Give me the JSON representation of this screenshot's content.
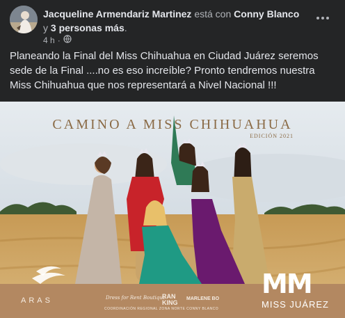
{
  "post": {
    "author": "Jacqueline Armendariz Martinez",
    "with_word": "está con",
    "tagged": "Conny Blanco",
    "and_word": "y",
    "others": "3 personas más",
    "period": ".",
    "time": "4 h",
    "dot": "·",
    "text": "Planeando la Final del Miss Chihuahua en Ciudad Juárez seremos sede de la Final ....no es eso increíble? Pronto tendremos nuestra Miss Chihuahua que nos representará a Nivel Nacional !!!"
  },
  "photo": {
    "title": "CAMINO A MISS CHIHUAHUA",
    "edition": "EDICIÓN 2021",
    "footer": {
      "aras": "ARAS",
      "dress": "Dress for Rent Boutique",
      "ranking_top": "RAN",
      "ranking_bottom": "KING",
      "marlene": "MARLENE BO",
      "coordination": "COORDINACIÓN REGIONAL ZONA NORTE CONNY BLANCO",
      "mm": "MM",
      "miss_juarez": "MISS JUÁREZ"
    }
  },
  "icons": {
    "more": "more-options-icon",
    "globe": "globe-icon",
    "avatar": "avatar"
  },
  "colors": {
    "background": "#242526",
    "primary_text": "#e4e6eb",
    "secondary_text": "#b0b3b8"
  }
}
